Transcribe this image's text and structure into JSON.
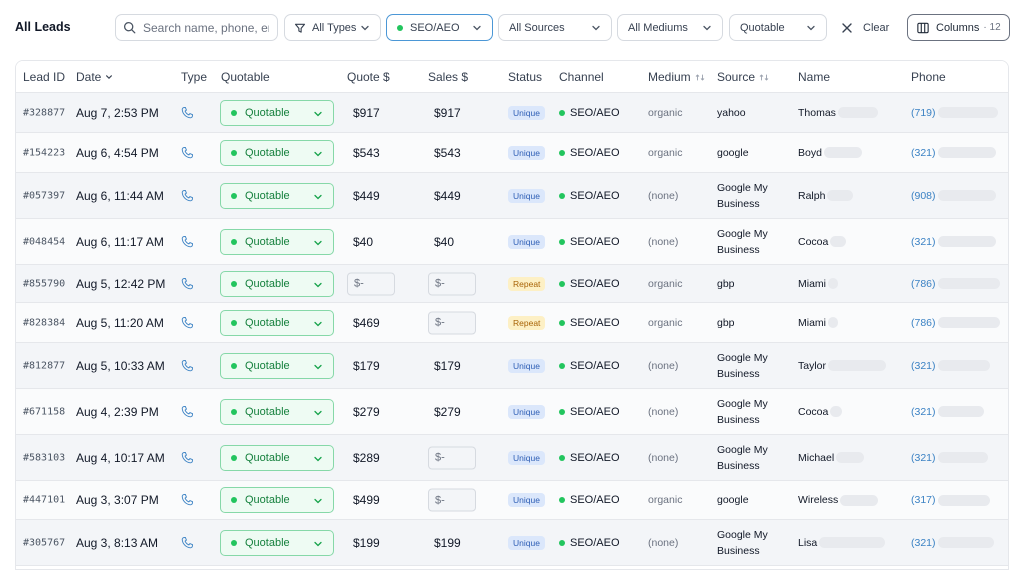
{
  "page_title": "All Leads",
  "search": {
    "placeholder": "Search name, phone, email",
    "value": ""
  },
  "filters": {
    "types": "All Types",
    "channel": "SEO/AEO",
    "sources": "All Sources",
    "mediums": "All Mediums",
    "quotable": "Quotable"
  },
  "actions": {
    "clear": "Clear",
    "columns": "Columns",
    "columns_count": "· 12"
  },
  "colors": {
    "accent": "#4b97d6",
    "green": "#22c55e",
    "phone_link": "#3b82c4"
  },
  "table": {
    "headers": {
      "lead_id": "Lead ID",
      "date": "Date",
      "type": "Type",
      "quotable": "Quotable",
      "quote": "Quote $",
      "sales": "Sales $",
      "status": "Status",
      "channel": "Channel",
      "medium": "Medium",
      "source": "Source",
      "name": "Name",
      "phone": "Phone"
    },
    "rows": [
      {
        "id": "#328877",
        "date": "Aug 7, 2:53 PM",
        "type_icon": "phone-icon",
        "quotable": "Quotable",
        "quote": "$917",
        "sales": "$917",
        "status": "Unique",
        "channel": "SEO/AEO",
        "medium": "organic",
        "source": "yahoo",
        "name": "Thomas",
        "phone": "(719)"
      },
      {
        "id": "#154223",
        "date": "Aug 6, 4:54 PM",
        "type_icon": "phone-icon",
        "quotable": "Quotable",
        "quote": "$543",
        "sales": "$543",
        "status": "Unique",
        "channel": "SEO/AEO",
        "medium": "organic",
        "source": "google",
        "name": "Boyd",
        "phone": "(321)"
      },
      {
        "id": "#057397",
        "date": "Aug 6, 11:44 AM",
        "type_icon": "phone-icon",
        "quotable": "Quotable",
        "quote": "$449",
        "sales": "$449",
        "status": "Unique",
        "channel": "SEO/AEO",
        "medium": "(none)",
        "source": "Google My Business",
        "name": "Ralph",
        "phone": "(908)"
      },
      {
        "id": "#048454",
        "date": "Aug 6, 11:17 AM",
        "type_icon": "phone-icon",
        "quotable": "Quotable",
        "quote": "$40",
        "sales": "$40",
        "status": "Unique",
        "channel": "SEO/AEO",
        "medium": "(none)",
        "source": "Google My Business",
        "name": "Cocoa",
        "phone": "(321)"
      },
      {
        "id": "#855790",
        "date": "Aug 5, 12:42 PM",
        "type_icon": "phone-icon",
        "quotable": "Quotable",
        "quote": "$-",
        "sales": "$-",
        "status": "Repeat",
        "channel": "SEO/AEO",
        "medium": "organic",
        "source": "gbp",
        "name": "Miami",
        "phone": "(786)"
      },
      {
        "id": "#828384",
        "date": "Aug 5, 11:20 AM",
        "type_icon": "phone-icon",
        "quotable": "Quotable",
        "quote": "$469",
        "sales": "$-",
        "status": "Repeat",
        "channel": "SEO/AEO",
        "medium": "organic",
        "source": "gbp",
        "name": "Miami",
        "phone": "(786)"
      },
      {
        "id": "#812877",
        "date": "Aug 5, 10:33 AM",
        "type_icon": "phone-icon",
        "quotable": "Quotable",
        "quote": "$179",
        "sales": "$179",
        "status": "Unique",
        "channel": "SEO/AEO",
        "medium": "(none)",
        "source": "Google My Business",
        "name": "Taylor",
        "phone": "(321)"
      },
      {
        "id": "#671158",
        "date": "Aug 4, 2:39 PM",
        "type_icon": "phone-icon",
        "quotable": "Quotable",
        "quote": "$279",
        "sales": "$279",
        "status": "Unique",
        "channel": "SEO/AEO",
        "medium": "(none)",
        "source": "Google My Business",
        "name": "Cocoa",
        "phone": "(321)"
      },
      {
        "id": "#583103",
        "date": "Aug 4, 10:17 AM",
        "type_icon": "phone-icon",
        "quotable": "Quotable",
        "quote": "$289",
        "sales": "$-",
        "status": "Unique",
        "channel": "SEO/AEO",
        "medium": "(none)",
        "source": "Google My Business",
        "name": "Michael",
        "phone": "(321)"
      },
      {
        "id": "#447101",
        "date": "Aug 3, 3:07 PM",
        "type_icon": "phone-icon",
        "quotable": "Quotable",
        "quote": "$499",
        "sales": "$-",
        "status": "Unique",
        "channel": "SEO/AEO",
        "medium": "organic",
        "source": "google",
        "name": "Wireless",
        "phone": "(317)"
      },
      {
        "id": "#305767",
        "date": "Aug 3, 8:13 AM",
        "type_icon": "phone-icon",
        "quotable": "Quotable",
        "quote": "$199",
        "sales": "$199",
        "status": "Unique",
        "channel": "SEO/AEO",
        "medium": "(none)",
        "source": "Google My Business",
        "name": "Lisa",
        "phone": "(321)"
      }
    ]
  }
}
